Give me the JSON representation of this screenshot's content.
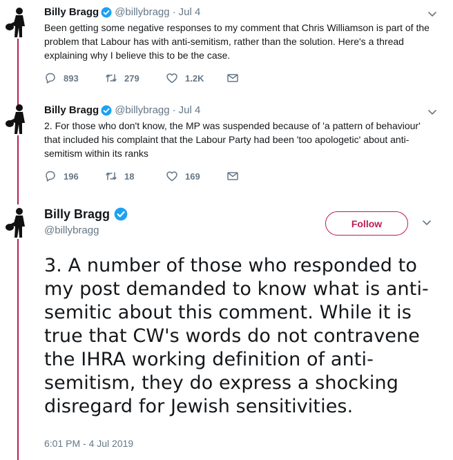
{
  "tweets": [
    {
      "name": "Billy Bragg",
      "handle": "@billybragg",
      "separator": "·",
      "date": "Jul 4",
      "text": "Been getting some negative responses to my comment that Chris Williamson is part of the problem that Labour has with anti-semitism, rather than the solution. Here's a thread explaining why I believe this to be the case.",
      "replies": "893",
      "retweets": "279",
      "likes": "1.2K"
    },
    {
      "name": "Billy Bragg",
      "handle": "@billybragg",
      "separator": "·",
      "date": "Jul 4",
      "text": "2. For those who don't know, the MP was suspended because of 'a pattern of behaviour' that included his complaint that the Labour Party had been 'too apologetic' about anti-semitism within its ranks",
      "replies": "196",
      "retweets": "18",
      "likes": "169"
    }
  ],
  "main_tweet": {
    "name": "Billy Bragg",
    "handle": "@billybragg",
    "follow_label": "Follow",
    "text": "3. A number of those who responded to my post demanded to know what is anti-semitic about this comment. While it is true that CW's words do not contravene the IHRA working definition of anti-semitism, they do express a shocking disregard for Jewish sensitivities.",
    "timestamp": "6:01 PM - 4 Jul 2019"
  },
  "colors": {
    "accent": "#ba1b54",
    "verified": "#1da1f2",
    "secondary_text": "#657786"
  },
  "icons": [
    "avatar",
    "verified-badge-icon",
    "chevron-down-icon",
    "reply-icon",
    "retweet-icon",
    "like-icon",
    "direct-message-icon"
  ]
}
